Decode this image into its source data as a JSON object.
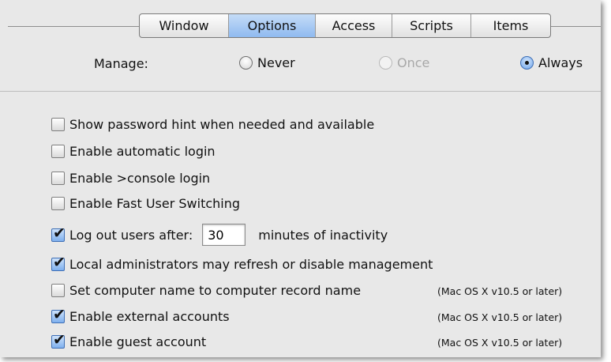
{
  "tabs": [
    {
      "label": "Window",
      "active": false
    },
    {
      "label": "Options",
      "active": true
    },
    {
      "label": "Access",
      "active": false
    },
    {
      "label": "Scripts",
      "active": false
    },
    {
      "label": "Items",
      "active": false
    }
  ],
  "manage": {
    "label": "Manage:",
    "options": [
      {
        "label": "Never",
        "selected": false,
        "enabled": true
      },
      {
        "label": "Once",
        "selected": false,
        "enabled": false
      },
      {
        "label": "Always",
        "selected": true,
        "enabled": true
      }
    ]
  },
  "options": [
    {
      "label": "Show password hint when needed and available",
      "checked": false
    },
    {
      "label": "Enable automatic login",
      "checked": false
    },
    {
      "label": "Enable >console login",
      "checked": false
    },
    {
      "label": "Enable Fast User Switching",
      "checked": false
    },
    {
      "label": "Log out users after:",
      "checked": true,
      "input_value": "30",
      "suffix": "minutes of inactivity"
    },
    {
      "label": "Local administrators may refresh or disable management",
      "checked": true
    },
    {
      "label": "Set computer name to computer record name",
      "checked": false,
      "note": "(Mac OS X v10.5 or later)"
    },
    {
      "label": "Enable external accounts",
      "checked": true,
      "note": "(Mac OS X v10.5 or later)"
    },
    {
      "label": "Enable guest account",
      "checked": true,
      "note": "(Mac OS X v10.5 or later)"
    }
  ],
  "colors": {
    "panel_bg": "#e8e8e8",
    "active_tab": "#8fbaf0",
    "disabled_text": "#a8a8a8"
  }
}
